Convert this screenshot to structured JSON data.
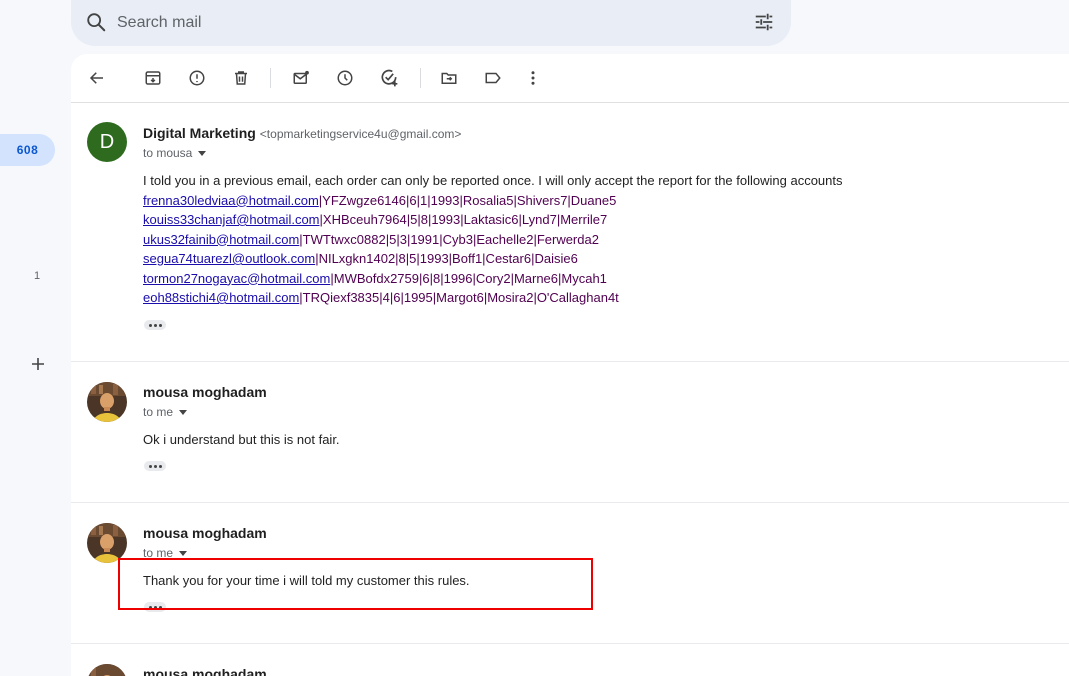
{
  "search": {
    "placeholder": "Search mail"
  },
  "left_rail": {
    "inbox_count": "608",
    "secondary_count": "1"
  },
  "toolbar": {
    "buttons": [
      "back",
      "archive",
      "report-spam",
      "delete",
      "mark-unread",
      "snooze",
      "add-to-tasks",
      "move-to",
      "labels",
      "more"
    ]
  },
  "messages": [
    {
      "sender_name": "Digital Marketing",
      "sender_email": "<topmarketingservice4u@gmail.com>",
      "to": "to mousa",
      "avatar_letter": "D",
      "intro": "I told you in a previous email, each order can only be reported once. I will only accept the report for the following accounts",
      "accounts": [
        {
          "email": "frenna30ledviaa@hotmail.com",
          "rest": "|YFZwgze6146|6|1|1993|Rosalia5|Shivers7|Duane5"
        },
        {
          "email": "kouiss33chanjaf@hotmail.com",
          "rest": "|XHBceuh7964|5|8|1993|Laktasic6|Lynd7|Merrile7"
        },
        {
          "email": "ukus32fainib@hotmail.com",
          "rest": "|TWTtwxc0882|5|3|1991|Cyb3|Eachelle2|Ferwerda2"
        },
        {
          "email": "segua74tuarezl@outlook.com",
          "rest": "|NILxgkn1402|8|5|1993|Boff1|Cestar6|Daisie6"
        },
        {
          "email": "tormon27nogayac@hotmail.com",
          "rest": "|MWBofdx2759|6|8|1996|Cory2|Marne6|Mycah1"
        },
        {
          "email": "eoh88stichi4@hotmail.com",
          "rest": "|TRQiexf3835|4|6|1995|Margot6|Mosira2|O'Callaghan4t"
        }
      ]
    },
    {
      "sender_name": "mousa moghadam",
      "to": "to me",
      "text": "Ok i understand but this is not fair."
    },
    {
      "sender_name": "mousa moghadam",
      "to": "to me",
      "text": "Thank you for your time i will told my customer this rules."
    },
    {
      "sender_name": "mousa moghadam"
    }
  ],
  "colors": {
    "accent": "#0b57d0",
    "highlight": "#e00000",
    "avatar_green": "#2e6b1f"
  }
}
